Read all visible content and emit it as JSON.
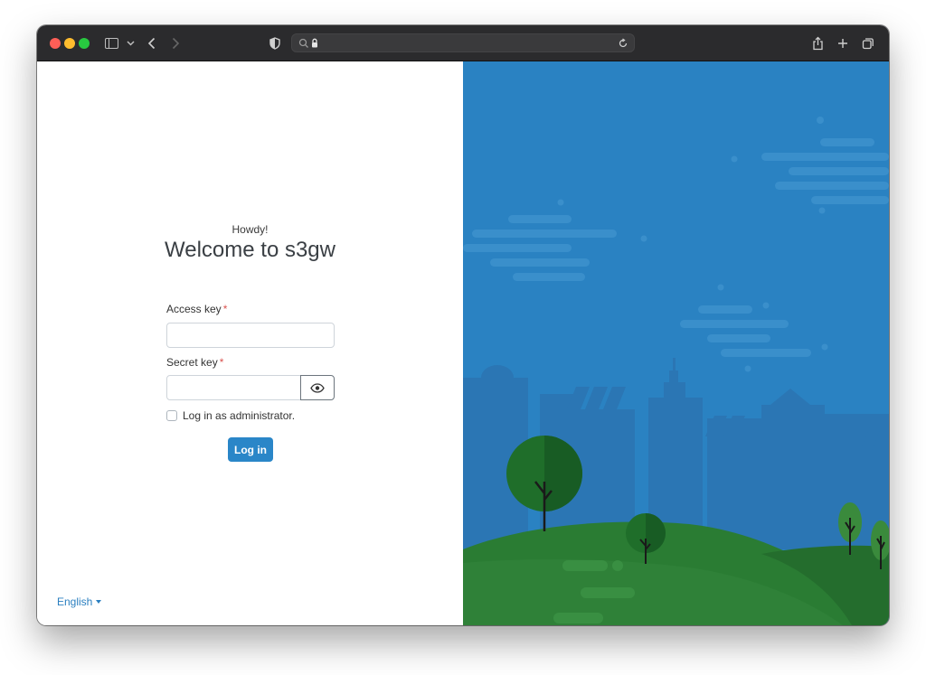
{
  "browser": {
    "address_text": "",
    "icons": [
      "sidebar-icon",
      "chevron-down-icon",
      "back-icon",
      "forward-icon",
      "shield-icon",
      "search-icon",
      "lock-icon",
      "reload-icon",
      "share-icon",
      "plus-icon",
      "tabs-icon"
    ]
  },
  "login": {
    "greeting": "Howdy!",
    "title": "Welcome to s3gw",
    "access_key_label": "Access key",
    "secret_key_label": "Secret key",
    "required_marker": "*",
    "access_key_value": "",
    "secret_key_value": "",
    "admin_checkbox_label": "Log in as administrator.",
    "admin_checked": false,
    "submit_label": "Log in"
  },
  "footer": {
    "language": "English"
  },
  "colors": {
    "primary": "#2a86c8",
    "illustration_sky": "#2a82c2",
    "hill_green": "#2a7c33",
    "required": "#d9534f"
  }
}
